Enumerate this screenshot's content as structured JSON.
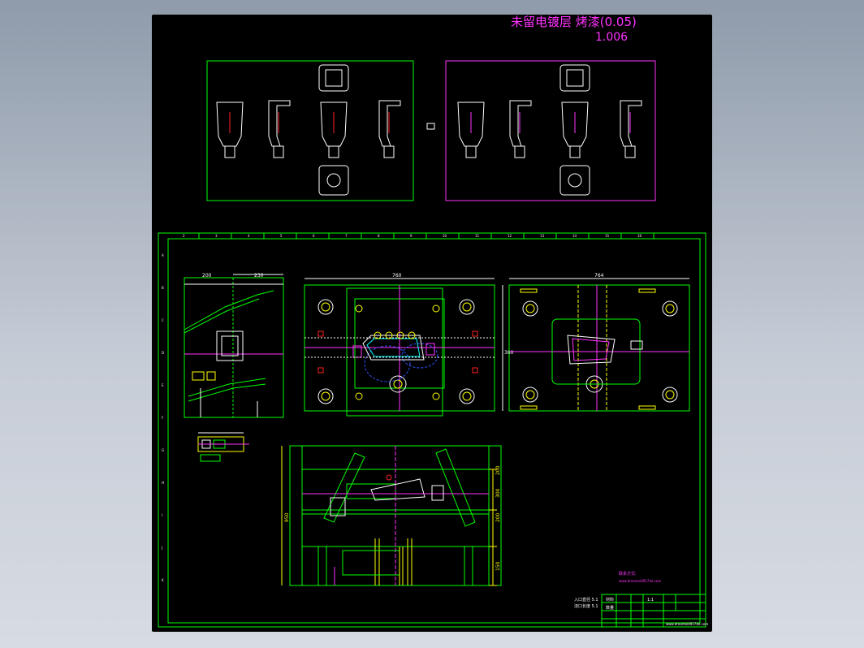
{
  "drawing": {
    "finish_note": "未留电镀层 烤漆(0.05)",
    "shrink_factor": "1.006",
    "dimensions": {
      "side_left_top_a": "200",
      "side_left_top_b": "230",
      "plate_a_width": "760",
      "plate_a_height": "380",
      "plate_b_width": "764",
      "section_heights": [
        "200",
        "300",
        "200",
        "150"
      ],
      "section_total": "950"
    },
    "grid_numbers": [
      "2",
      "3",
      "4",
      "5",
      "6",
      "7",
      "8",
      "9",
      "10",
      "11",
      "12",
      "13",
      "14",
      "15",
      "16"
    ],
    "grid_letters": [
      "A",
      "B",
      "C",
      "D",
      "E",
      "F",
      "G",
      "H",
      "I",
      "J",
      "K"
    ],
    "scale_text": "1:1",
    "contact_heading": "联系方式:",
    "contact_url": "www.dreamold917de.com",
    "title_block": {
      "notes": [
        "入口直径 5.1",
        "浇口长度 5.1"
      ],
      "headers": [
        "材料",
        "数量"
      ],
      "footer_url": "www.dreamold917de.com"
    }
  },
  "colors": {
    "background": "#000000",
    "frame": "#00ff00",
    "magenta": "#ff33ff",
    "white": "#ffffff",
    "yellow": "#ffff00",
    "red": "#ff2222",
    "cyan": "#00ffff",
    "blue": "#3355ff"
  }
}
